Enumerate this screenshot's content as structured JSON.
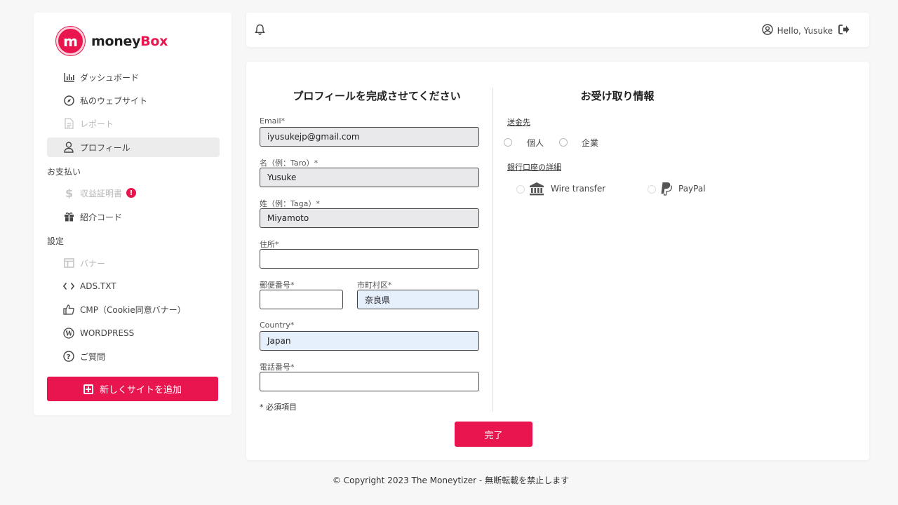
{
  "brand": {
    "logo_letter": "m",
    "name_part1": "money",
    "name_part2": "Box"
  },
  "colors": {
    "accent": "#e8154e",
    "field_grey": "#e9e9ec",
    "field_blue": "#e6effc"
  },
  "sidebar": {
    "items": [
      {
        "label": "ダッシュボード",
        "icon": "bar-chart-icon"
      },
      {
        "label": "私のウェブサイト",
        "icon": "compass-icon"
      },
      {
        "label": "レポート",
        "icon": "document-icon"
      },
      {
        "label": "プロフィール",
        "icon": "user-icon"
      }
    ],
    "section_payments": "お支払い",
    "payment_items": [
      {
        "label": "収益証明書",
        "icon": "dollar-icon",
        "badge": "!"
      },
      {
        "label": "紹介コード",
        "icon": "gift-icon"
      }
    ],
    "section_settings": "設定",
    "settings_items": [
      {
        "label": "バナー",
        "icon": "layout-icon"
      },
      {
        "label": "ADS.TXT",
        "icon": "code-icon"
      },
      {
        "label": "CMP（Cookie同意バナー）",
        "icon": "thumbs-up-icon"
      },
      {
        "label": "WORDPRESS",
        "icon": "wordpress-icon"
      },
      {
        "label": "ご質問",
        "icon": "question-icon"
      }
    ],
    "add_site_label": "新しくサイトを追加"
  },
  "topbar": {
    "greeting": "Hello, Yusuke"
  },
  "form": {
    "title": "プロフィールを完成させてください",
    "email_label": "Email*",
    "email_value": "iyusukejp@gmail.com",
    "first_name_label": "名（例：Taro）*",
    "first_name_value": "Yusuke",
    "last_name_label": "姓（例：Taga）*",
    "last_name_value": "Miyamoto",
    "address_label": "住所*",
    "address_value": "",
    "postal_label": "郵便番号*",
    "postal_value": "",
    "city_label": "市町村区*",
    "city_value": "奈良県",
    "country_label": "Country*",
    "country_value": "Japan",
    "phone_label": "電話番号*",
    "phone_value": "",
    "required_note": "* 必須項目",
    "submit_label": "完了"
  },
  "receive": {
    "title": "お受け取り情報",
    "recipient_label": "送金先",
    "recipient_options": [
      "個人",
      "企業"
    ],
    "bank_label": "銀行口座の詳細",
    "methods": [
      {
        "label": "Wire transfer",
        "icon": "bank-icon"
      },
      {
        "label": "PayPal",
        "icon": "paypal-icon"
      }
    ]
  },
  "footer": {
    "text": "© Copyright 2023 The Moneytizer - 無断転載を禁止します"
  }
}
